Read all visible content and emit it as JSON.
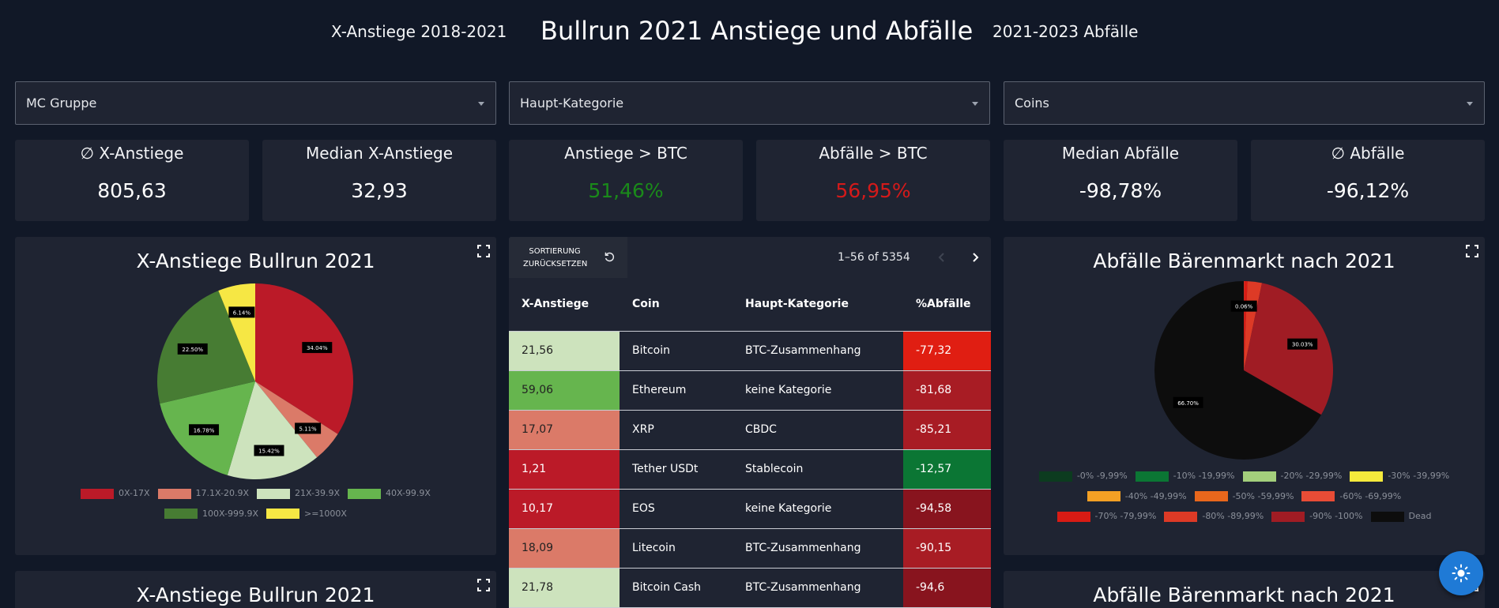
{
  "nav": {
    "left_link": "X-Anstiege 2018-2021",
    "title": "Bullrun 2021 Anstiege und Abfälle",
    "right_link": "2021-2023 Abfälle"
  },
  "filters": [
    {
      "label": "MC Gruppe"
    },
    {
      "label": "Haupt-Kategorie"
    },
    {
      "label": "Coins"
    }
  ],
  "kpis": [
    {
      "title": "∅ X-Anstiege",
      "value": "805,63",
      "color": "#ffffff"
    },
    {
      "title": "Median X-Anstiege",
      "value": "32,93",
      "color": "#ffffff"
    },
    {
      "title": "Anstiege > BTC",
      "value": "51,46%",
      "color": "#1a8a1a"
    },
    {
      "title": "Abfälle > BTC",
      "value": "56,95%",
      "color": "#d41a1a"
    },
    {
      "title": "Median Abfälle",
      "value": "-98,78%",
      "color": "#ffffff"
    },
    {
      "title": "∅ Abfälle",
      "value": "-96,12%",
      "color": "#ffffff"
    }
  ],
  "left_chart_title": "X-Anstiege Bullrun 2021",
  "right_chart_title": "Abfälle Bärenmarkt nach 2021",
  "left_chart_title_2": "X-Anstiege Bullrun 2021",
  "right_chart_title_2": "Abfälle Bärenmarkt nach 2021",
  "chart_data": [
    {
      "type": "pie",
      "title": "X-Anstiege Bullrun 2021",
      "categories": [
        "0X-17X",
        "17.1X-20.9X",
        "21X-39.9X",
        "40X-99.9X",
        "100X-999.9X",
        ">=1000X"
      ],
      "values": [
        34.04,
        5.11,
        15.42,
        16.78,
        22.5,
        6.14
      ],
      "labels": [
        "34.04%",
        "5.11%",
        "15.42%",
        "16.78%",
        "22.50%",
        "6.14%"
      ],
      "colors": [
        "#bb1a28",
        "#db7a68",
        "#cde3bd",
        "#66b54e",
        "#477c33",
        "#f6e744"
      ],
      "legend_position": "bottom"
    },
    {
      "type": "pie",
      "title": "Abfälle Bärenmarkt nach 2021",
      "categories": [
        "-0% -9,99%",
        "-10% -19,99%",
        "-20% -29,99%",
        "-30% -39,99%",
        "-40% -49,99%",
        "-50% -59,99%",
        "-60% -69,99%",
        "-70% -79,99%",
        "-80% -89,99%",
        "-90% -100%",
        "Dead"
      ],
      "values": [
        0,
        0,
        0,
        0,
        0,
        0,
        0.06,
        0.6,
        2.61,
        30.03,
        66.7
      ],
      "labels": [
        "",
        "",
        "",
        "",
        "",
        "",
        "0.06%",
        "",
        "",
        "30.03%",
        "66.70%"
      ],
      "colors": [
        "#0c3b1f",
        "#0b7634",
        "#a3cf7c",
        "#f5ea3c",
        "#f4a024",
        "#e8671c",
        "#e84c36",
        "#d81b14",
        "#dd3a26",
        "#a01c24",
        "#0d0d0d"
      ],
      "legend_position": "bottom"
    }
  ],
  "table": {
    "reset_label_1": "SORTIERUNG",
    "reset_label_2": "ZURÜCKSETZEN",
    "pagination": "1–56 of 5354",
    "headers": [
      "X-Anstiege",
      "Coin",
      "Haupt-Kategorie",
      "%Abfälle"
    ],
    "rows": [
      {
        "x": "21,56",
        "coin": "Bitcoin",
        "cat": "BTC-Zusammenhang",
        "pct": "-77,32",
        "xc": "#cde3bd",
        "xt": "#222222",
        "pc": "#e01e12"
      },
      {
        "x": "59,06",
        "coin": "Ethereum",
        "cat": "keine Kategorie",
        "pct": "-81,68",
        "xc": "#66b54e",
        "xt": "#222222",
        "pc": "#a81c24"
      },
      {
        "x": "17,07",
        "coin": "XRP",
        "cat": "CBDC",
        "pct": "-85,21",
        "xc": "#db7a68",
        "xt": "#222222",
        "pc": "#a81c24"
      },
      {
        "x": "1,21",
        "coin": "Tether USDt",
        "cat": "Stablecoin",
        "pct": "-12,57",
        "xc": "#bb1a28",
        "xt": "#ffffff",
        "pc": "#0b7634"
      },
      {
        "x": "10,17",
        "coin": "EOS",
        "cat": "keine Kategorie",
        "pct": "-94,58",
        "xc": "#bb1a28",
        "xt": "#ffffff",
        "pc": "#88141e"
      },
      {
        "x": "18,09",
        "coin": "Litecoin",
        "cat": "BTC-Zusammenhang",
        "pct": "-90,15",
        "xc": "#db7a68",
        "xt": "#222222",
        "pc": "#a81c24"
      },
      {
        "x": "21,78",
        "coin": "Bitcoin Cash",
        "cat": "BTC-Zusammenhang",
        "pct": "-94,6",
        "xc": "#cde3bd",
        "xt": "#222222",
        "pc": "#88141e"
      }
    ]
  },
  "icons": {
    "expand": "expand-icon",
    "reset": "reset-icon",
    "prev": "chevron-left-icon",
    "next": "chevron-right-icon",
    "theme": "sun-icon"
  }
}
